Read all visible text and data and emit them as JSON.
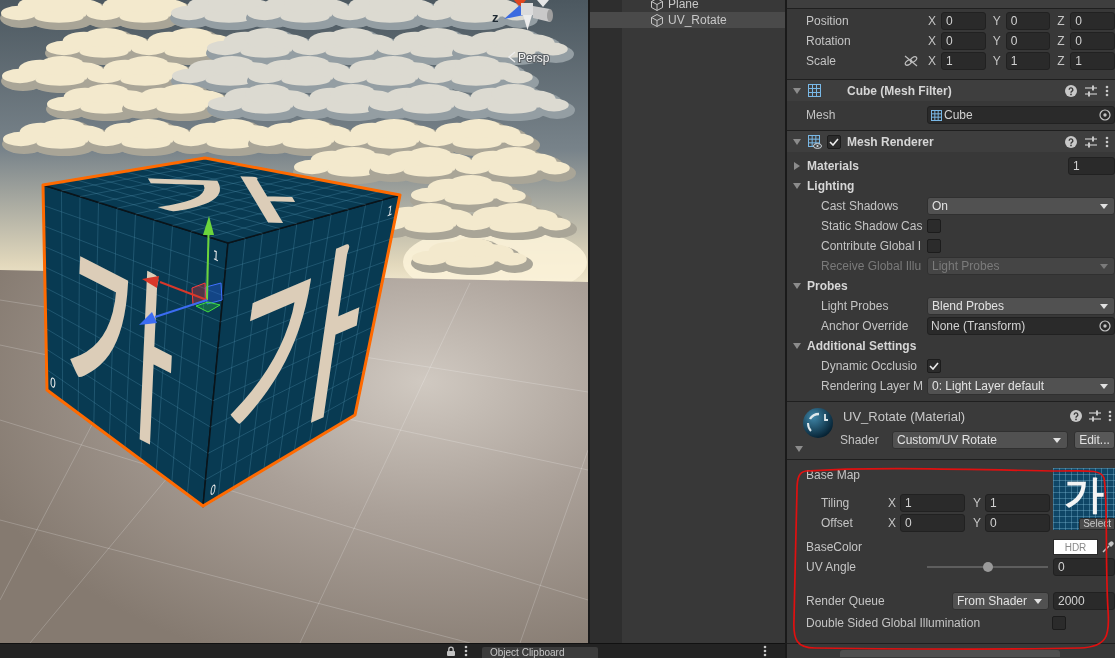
{
  "scene_view": {
    "orientation_gizmo": {
      "axis_label": "z",
      "projection": "Persp"
    },
    "cube": {
      "selected": true,
      "faces": [
        {
          "kind": "left",
          "glyph": "가",
          "corner_labels": [
            "1",
            "0"
          ]
        },
        {
          "kind": "right",
          "glyph": "가",
          "corner_labels": [
            "1",
            "0"
          ]
        },
        {
          "kind": "top",
          "glyph": "가"
        }
      ]
    }
  },
  "hierarchy": {
    "items": [
      {
        "label": "Plane",
        "selected": false
      },
      {
        "label": "UV_Rotate",
        "selected": true
      }
    ]
  },
  "inspector": {
    "transform": {
      "rows": [
        {
          "label": "Position",
          "fields": [
            {
              "axis": "X",
              "value": "0"
            },
            {
              "axis": "Y",
              "value": "0"
            },
            {
              "axis": "Z",
              "value": "0"
            }
          ]
        },
        {
          "label": "Rotation",
          "fields": [
            {
              "axis": "X",
              "value": "0"
            },
            {
              "axis": "Y",
              "value": "0"
            },
            {
              "axis": "Z",
              "value": "0"
            }
          ]
        },
        {
          "label": "Scale",
          "proportional": false,
          "fields": [
            {
              "axis": "X",
              "value": "1"
            },
            {
              "axis": "Y",
              "value": "1"
            },
            {
              "axis": "Z",
              "value": "1"
            }
          ]
        }
      ]
    },
    "components": [
      {
        "kind": "mesh_filter",
        "title": "Cube (Mesh Filter)",
        "expanded": true,
        "properties": [
          {
            "kind": "object",
            "label": "Mesh",
            "value": "Cube",
            "icon": true
          }
        ]
      },
      {
        "kind": "mesh_renderer",
        "title": "Mesh Renderer",
        "expanded": true,
        "enabled": true,
        "properties": [
          {
            "kind": "foldout",
            "label": "Materials",
            "expanded": false,
            "value": "1"
          },
          {
            "kind": "foldout",
            "label": "Lighting",
            "expanded": true,
            "children": [
              {
                "kind": "dropdown",
                "label": "Cast Shadows",
                "value": "On",
                "disabled": false
              },
              {
                "kind": "checkbox",
                "label": "Static Shadow Cas",
                "checked": false
              },
              {
                "kind": "checkbox",
                "label": "Contribute Global I",
                "checked": false
              },
              {
                "kind": "dropdown",
                "label": "Receive Global Illu",
                "value": "Light Probes",
                "disabled": true
              }
            ]
          },
          {
            "kind": "foldout",
            "label": "Probes",
            "expanded": true,
            "children": [
              {
                "kind": "dropdown",
                "label": "Light Probes",
                "value": "Blend Probes",
                "disabled": false
              },
              {
                "kind": "object",
                "label": "Anchor Override",
                "value": "None (Transform)"
              }
            ]
          },
          {
            "kind": "foldout",
            "label": "Additional Settings",
            "expanded": true,
            "children": [
              {
                "kind": "checkbox",
                "label": "Dynamic Occlusio",
                "checked": true
              },
              {
                "kind": "dropdown",
                "label": "Rendering Layer M",
                "value": "0: Light Layer default",
                "disabled": false
              }
            ]
          }
        ]
      }
    ],
    "material": {
      "title": "UV_Rotate (Material)",
      "expanded": true,
      "shader_label": "Shader",
      "shader": "Custom/UV Rotate",
      "edit_button": "Edit...",
      "properties": [
        {
          "kind": "texture",
          "label": "Base Map",
          "thumbnail_glyph": "가",
          "select_button": "Select",
          "rows": [
            {
              "label": "Tiling",
              "fields": [
                {
                  "axis": "X",
                  "value": "1"
                },
                {
                  "axis": "Y",
                  "value": "1"
                }
              ]
            },
            {
              "label": "Offset",
              "fields": [
                {
                  "axis": "X",
                  "value": "0"
                },
                {
                  "axis": "Y",
                  "value": "0"
                }
              ]
            }
          ]
        },
        {
          "kind": "color",
          "label": "BaseColor",
          "color": "#ffffff",
          "badge": "HDR"
        },
        {
          "kind": "slider",
          "label": "UV Angle",
          "level": 0.5,
          "value": "0"
        },
        {
          "kind": "queue",
          "label": "Render Queue",
          "mode": "From Shader",
          "value": "2000"
        },
        {
          "kind": "checkbox",
          "label": "Double Sided Global Illumination",
          "checked": false
        }
      ]
    }
  },
  "bottom_bar": {
    "tabs": [
      {
        "label": "Object Clipboard",
        "selected": true
      }
    ]
  }
}
